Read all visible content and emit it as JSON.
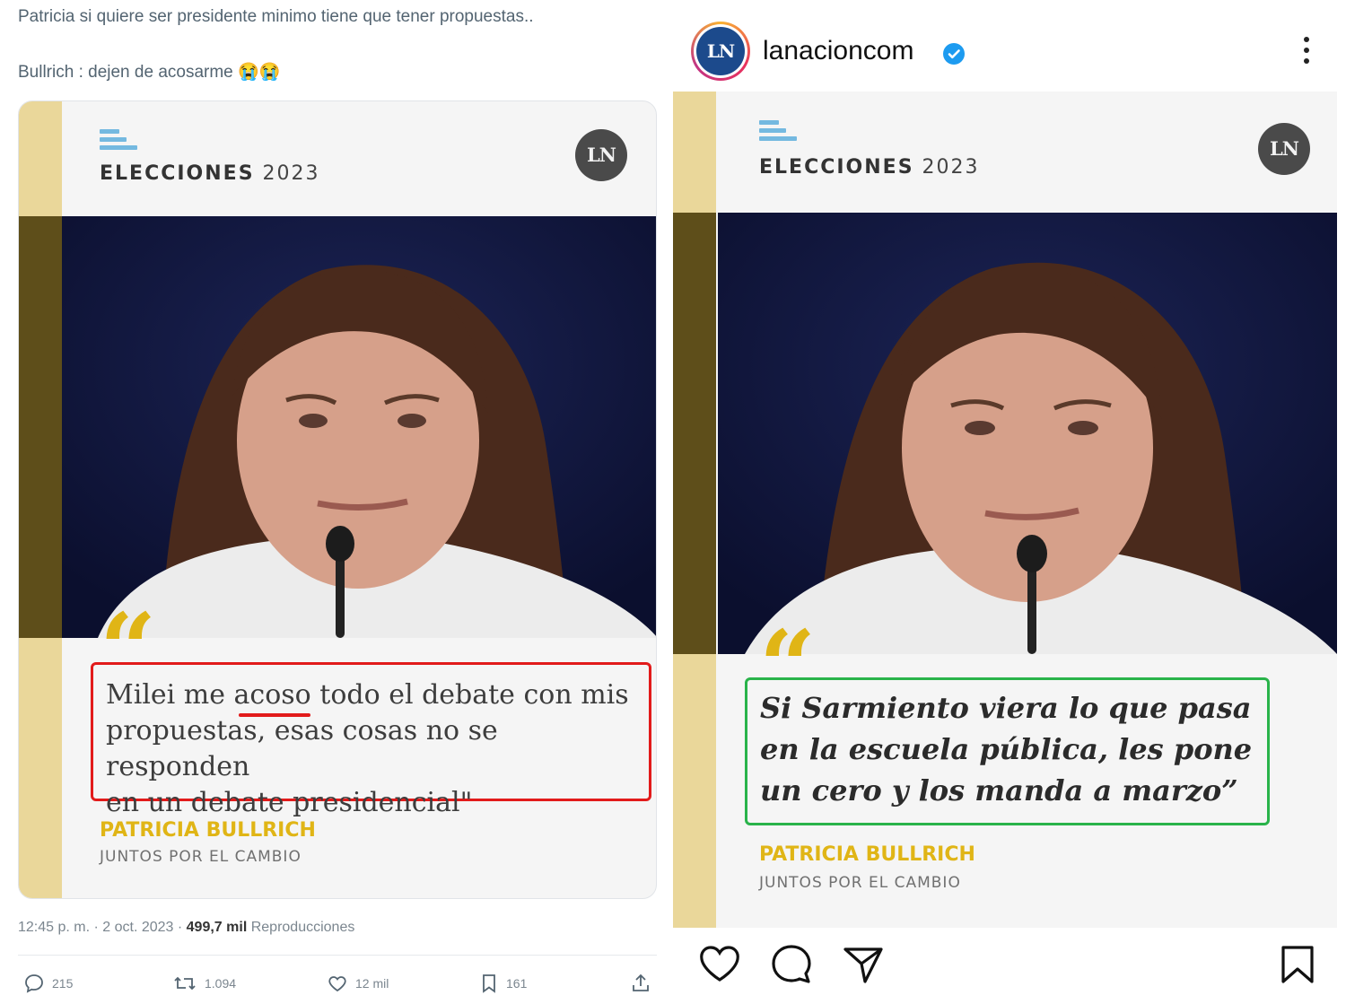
{
  "tweet": {
    "text_line_1": "Patricia si quiere ser presidente minimo tiene que tener propuestas..",
    "text_line_2": "Bullrich : dejen de acosarme 😭😭",
    "card": {
      "section_label": "ELECCIONES",
      "section_year": "2023",
      "badge": "LN",
      "quote": "Milei me acoso todo el debate con mis\npropuestas, esas cosas no se responden\nen un debate presidencial\"",
      "person": "PATRICIA BULLRICH",
      "party": "JUNTOS POR EL CAMBIO"
    },
    "meta": {
      "time": "12:45 p. m. · 2 oct. 2023 · ",
      "views": "499,7 mil",
      "views_label": " Reproducciones"
    },
    "actions": {
      "replies": "215",
      "reposts": "1.094",
      "likes": "12 mil",
      "bookmarks": "161"
    }
  },
  "instagram": {
    "avatar": "LN",
    "username": "lanacioncom",
    "card": {
      "section_label": "ELECCIONES",
      "section_year": "2023",
      "badge": "LN",
      "quote": "Si Sarmiento viera lo que pasa\nen la escuela pública, les pone\n un cero y los manda a marzo”",
      "person": "PATRICIA BULLRICH",
      "party": "JUNTOS POR EL CAMBIO"
    }
  },
  "colors": {
    "quote_yellow": "#e0b516",
    "highlight_red": "#e21b1b",
    "highlight_green": "#29b34a",
    "strip_yellow": "#ead79a",
    "instagram_verified": "#1d9bf0"
  }
}
